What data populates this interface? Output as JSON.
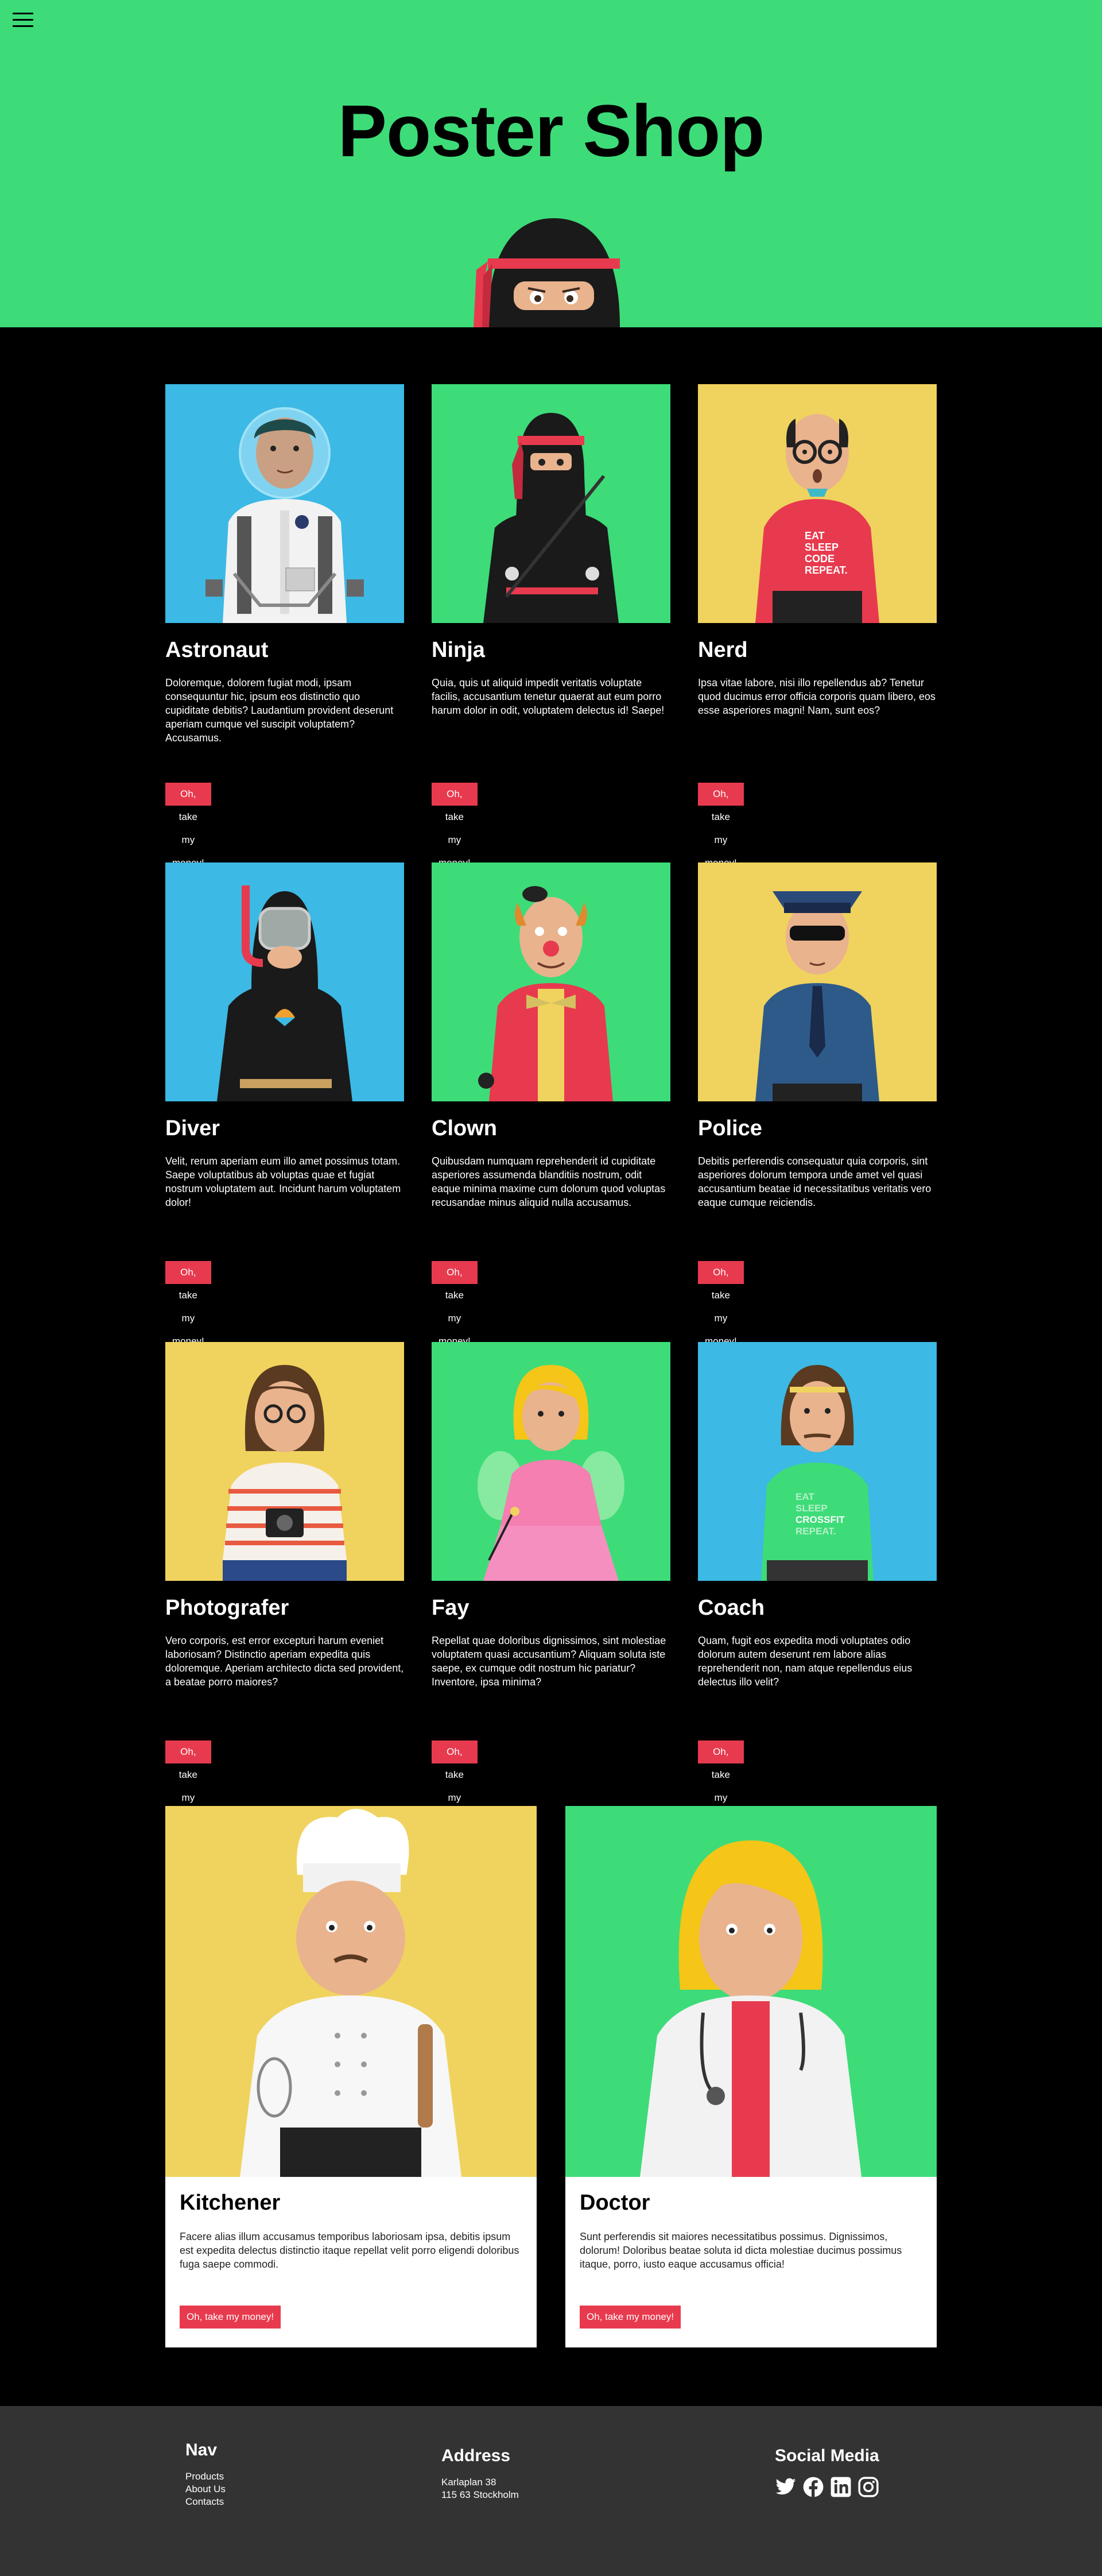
{
  "header": {
    "title": "Poster Shop",
    "menu_icon": "hamburger-icon",
    "bg_color": "#3ddc78"
  },
  "products": [
    {
      "name": "Astronaut",
      "bg": "#3cb9e4",
      "desc": "Doloremque, dolorem fugiat modi, ipsam consequuntur hic, ipsum eos distinctio quo cupiditate debitis? Laudantium provident deserunt aperiam cumque vel suscipit voluptatem? Accusamus.",
      "button": "Oh, take my money!"
    },
    {
      "name": "Ninja",
      "bg": "#3ddc78",
      "desc": "Quia, quis ut aliquid impedit veritatis voluptate facilis, accusantium tenetur quaerat aut eum porro harum dolor in odit, voluptatem delectus id! Saepe!",
      "button": "Oh, take my money!"
    },
    {
      "name": "Nerd",
      "bg": "#f0d35e",
      "desc": "Ipsa vitae labore, nisi illo repellendus ab? Tenetur quod ducimus error officia corporis quam libero, eos esse asperiores magni! Nam, sunt eos?",
      "button": "Oh, take my money!"
    },
    {
      "name": "Diver",
      "bg": "#3cb9e4",
      "desc": "Velit, rerum aperiam eum illo amet possimus totam. Saepe voluptatibus ab voluptas quae et fugiat nostrum voluptatem aut. Incidunt harum voluptatem dolor!",
      "button": "Oh, take my money!"
    },
    {
      "name": "Clown",
      "bg": "#3ddc78",
      "desc": "Quibusdam numquam reprehenderit id cupiditate asperiores assumenda blanditiis nostrum, odit eaque minima maxime cum dolorum quod voluptas recusandae minus aliquid nulla accusamus.",
      "button": "Oh, take my money!"
    },
    {
      "name": "Police",
      "bg": "#f0d35e",
      "desc": "Debitis perferendis consequatur quia corporis, sint asperiores dolorum tempora unde amet vel quasi accusantium beatae id necessitatibus veritatis vero eaque cumque reiciendis.",
      "button": "Oh, take my money!"
    },
    {
      "name": "Photografer",
      "bg": "#f0d35e",
      "desc": "Vero corporis, est error excepturi harum eveniet laboriosam? Distinctio aperiam expedita quis doloremque. Aperiam architecto dicta sed provident, a beatae porro maiores?",
      "button": "Oh, take my money!"
    },
    {
      "name": "Fay",
      "bg": "#3ddc78",
      "desc": "Repellat quae doloribus dignissimos, sint molestiae voluptatem quasi accusantium? Aliquam soluta iste saepe, ex cumque odit nostrum hic pariatur? Inventore, ipsa minima?",
      "button": "Oh, take my money!"
    },
    {
      "name": "Coach",
      "bg": "#3cb9e4",
      "desc": "Quam, fugit eos expedita modi voluptates odio dolorum autem deserunt rem labore alias reprehenderit non, nam atque repellendus eius delectus illo velit?",
      "button": "Oh, take my money!"
    }
  ],
  "featured": [
    {
      "name": "Kitchener",
      "bg": "#f0d35e",
      "desc": "Facere alias illum accusamus temporibus laboriosam ipsa, debitis ipsum est expedita delectus distinctio itaque repellat velit porro eligendi doloribus fuga saepe commodi.",
      "button": "Oh, take my money!"
    },
    {
      "name": "Doctor",
      "bg": "#3ddc78",
      "desc": "Sunt perferendis sit maiores necessitatibus possimus. Dignissimos, dolorum! Doloribus beatae soluta id dicta molestiae ducimus possimus itaque, porro, iusto eaque accusamus officia!",
      "button": "Oh, take my money!"
    }
  ],
  "artwork_text": {
    "nerd_shirt": [
      "EAT",
      "SLEEP",
      "CODE",
      "REPEAT."
    ],
    "coach_shirt": [
      "EAT",
      "SLEEP",
      "CROSSFIT",
      "REPEAT."
    ]
  },
  "footer": {
    "nav": {
      "title": "Nav",
      "links": [
        "Products",
        "About Us",
        "Contacts"
      ]
    },
    "address": {
      "title": "Address",
      "lines": [
        "Karlaplan 38",
        "115 63 Stockholm"
      ]
    },
    "social": {
      "title": "Social Media",
      "icons": [
        "twitter-icon",
        "facebook-icon",
        "linkedin-icon",
        "instagram-icon"
      ]
    },
    "bg_color": "#333333"
  }
}
